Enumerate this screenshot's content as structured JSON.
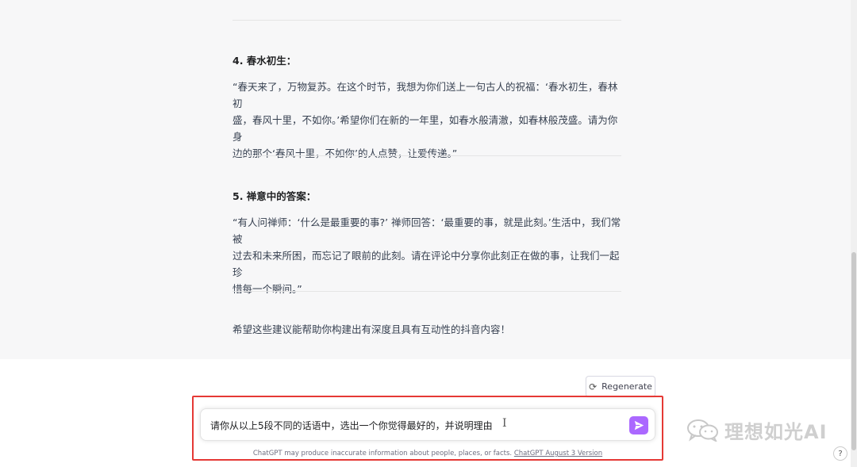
{
  "conversation": {
    "section4": {
      "heading": "4. 春水初生：",
      "body_lines": [
        "“春天来了，万物复苏。在这个时节，我想为你们送上一句古人的祝福：‘春水初生，春林初",
        "盛，春风十里，不如你。’希望你们在新的一年里，如春水般清澈，如春林般茂盛。请为你身",
        "边的那个‘春风十里，不如你’的人点赞，让爱传递。”"
      ]
    },
    "section5": {
      "heading": "5. 禅意中的答案：",
      "body_lines": [
        "“有人问禅师：‘什么是最重要的事?’ 禅师回答：‘最重要的事，就是此刻。’生活中，我们常被",
        "过去和未来所困，而忘记了眼前的此刻。请在评论中分享你此刻正在做的事，让我们一起珍",
        "惜每一个瞬间。”"
      ]
    },
    "closing": "希望这些建议能帮助你构建出有深度且具有互动性的抖音内容！"
  },
  "composer": {
    "regenerate_label": "Regenerate",
    "regenerate_icon": "refresh-icon",
    "input_value": "请你从以上5段不同的话语中，选出一个你觉得最好的，并说明理由",
    "send_icon": "paper-plane-icon",
    "send_color": "#ab68ff",
    "highlight_color": "#e53935"
  },
  "footer": {
    "disclaimer": "ChatGPT may produce inaccurate information about people, places, or facts.",
    "version_link": "ChatGPT August 3 Version"
  },
  "watermark": {
    "text": "理想如光AI",
    "icon": "wechat-icon"
  },
  "help": {
    "label": "?"
  }
}
